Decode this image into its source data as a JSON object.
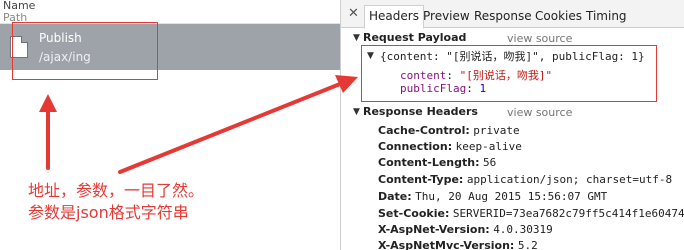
{
  "list": {
    "col_name": "Name",
    "col_path": "Path",
    "request": {
      "name": "Publish",
      "path": "/ajax/ing"
    }
  },
  "annotation": {
    "line1": "地址，参数，一目了然。",
    "line2": "参数是json格式字符串"
  },
  "tabs": {
    "close": "✕",
    "items": [
      "Headers",
      "Preview",
      "Response",
      "Cookies",
      "Timing"
    ]
  },
  "payload": {
    "title": "Request Payload",
    "view_source": "view source",
    "summary": "{content: \"[别说话，吻我]\", publicFlag: 1}",
    "content_key": "content",
    "content_value": "\"[别说话，吻我]\"",
    "flag_key": "publicFlag",
    "flag_value": "1"
  },
  "response_headers": {
    "title": "Response Headers",
    "view_source": "view source",
    "items": [
      {
        "key": "Cache-Control:",
        "value": "private"
      },
      {
        "key": "Connection:",
        "value": "keep-alive"
      },
      {
        "key": "Content-Length:",
        "value": "56"
      },
      {
        "key": "Content-Type:",
        "value": "application/json; charset=utf-8"
      },
      {
        "key": "Date:",
        "value": "Thu, 20 Aug 2015 15:56:07 GMT"
      },
      {
        "key": "Set-Cookie:",
        "value": "SERVERID=73ea7682c79ff5c414f1e604744"
      },
      {
        "key": "X-AspNet-Version:",
        "value": "4.0.30319"
      },
      {
        "key": "X-AspNetMvc-Version:",
        "value": "5.2"
      }
    ]
  },
  "colors": {
    "accent": "#e53935",
    "selected_row": "#9ea3a9"
  }
}
